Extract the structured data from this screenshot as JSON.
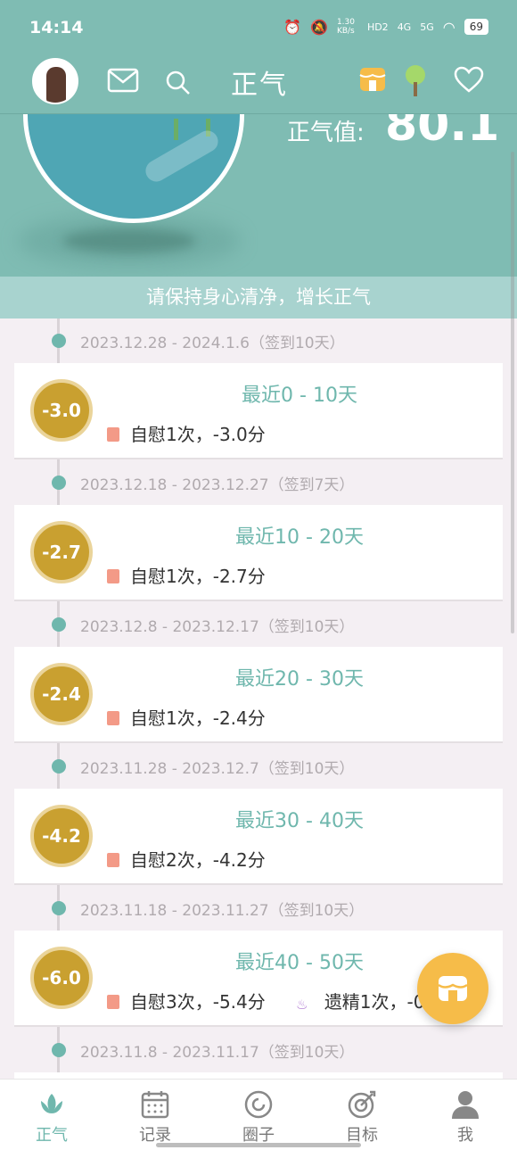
{
  "status_bar": {
    "time": "14:14",
    "net_speed": "1.30 KB/s",
    "hd": "HD2",
    "sig1": "4G",
    "sig2": "5G",
    "battery": "69"
  },
  "header": {
    "title": "正气"
  },
  "hero": {
    "zq_label": "正气值:",
    "zq_value": "80.1"
  },
  "banner": "请保持身心清净，增长正气",
  "periods": [
    {
      "date": "2023.12.28 - 2024.1.6（签到10天）",
      "score": "-3.0",
      "title": "最近0 - 10天",
      "stats": [
        "自慰1次，-3.0分"
      ]
    },
    {
      "date": "2023.12.18 - 2023.12.27（签到7天）",
      "score": "-2.7",
      "title": "最近10 - 20天",
      "stats": [
        "自慰1次，-2.7分"
      ]
    },
    {
      "date": "2023.12.8 - 2023.12.17（签到10天）",
      "score": "-2.4",
      "title": "最近20 - 30天",
      "stats": [
        "自慰1次，-2.4分"
      ]
    },
    {
      "date": "2023.11.28 - 2023.12.7（签到10天）",
      "score": "-4.2",
      "title": "最近30 - 40天",
      "stats": [
        "自慰2次，-4.2分"
      ]
    },
    {
      "date": "2023.11.18 - 2023.11.27（签到10天）",
      "score": "-6.0",
      "title": "最近40 - 50天",
      "stats": [
        "自慰3次，-5.4分",
        "遗精1次，-0"
      ]
    },
    {
      "date": "2023.11.8 - 2023.11.17（签到10天）"
    }
  ],
  "nav": [
    {
      "label": "正气",
      "icon": "lotus-icon"
    },
    {
      "label": "记录",
      "icon": "calendar-icon"
    },
    {
      "label": "圈子",
      "icon": "circle-icon"
    },
    {
      "label": "目标",
      "icon": "target-icon"
    },
    {
      "label": "我",
      "icon": "user-icon"
    }
  ],
  "colors": {
    "teal": "#7fbcb3",
    "accent": "#6fb7ad",
    "gold": "#c9a030",
    "fab": "#f6bc49"
  }
}
